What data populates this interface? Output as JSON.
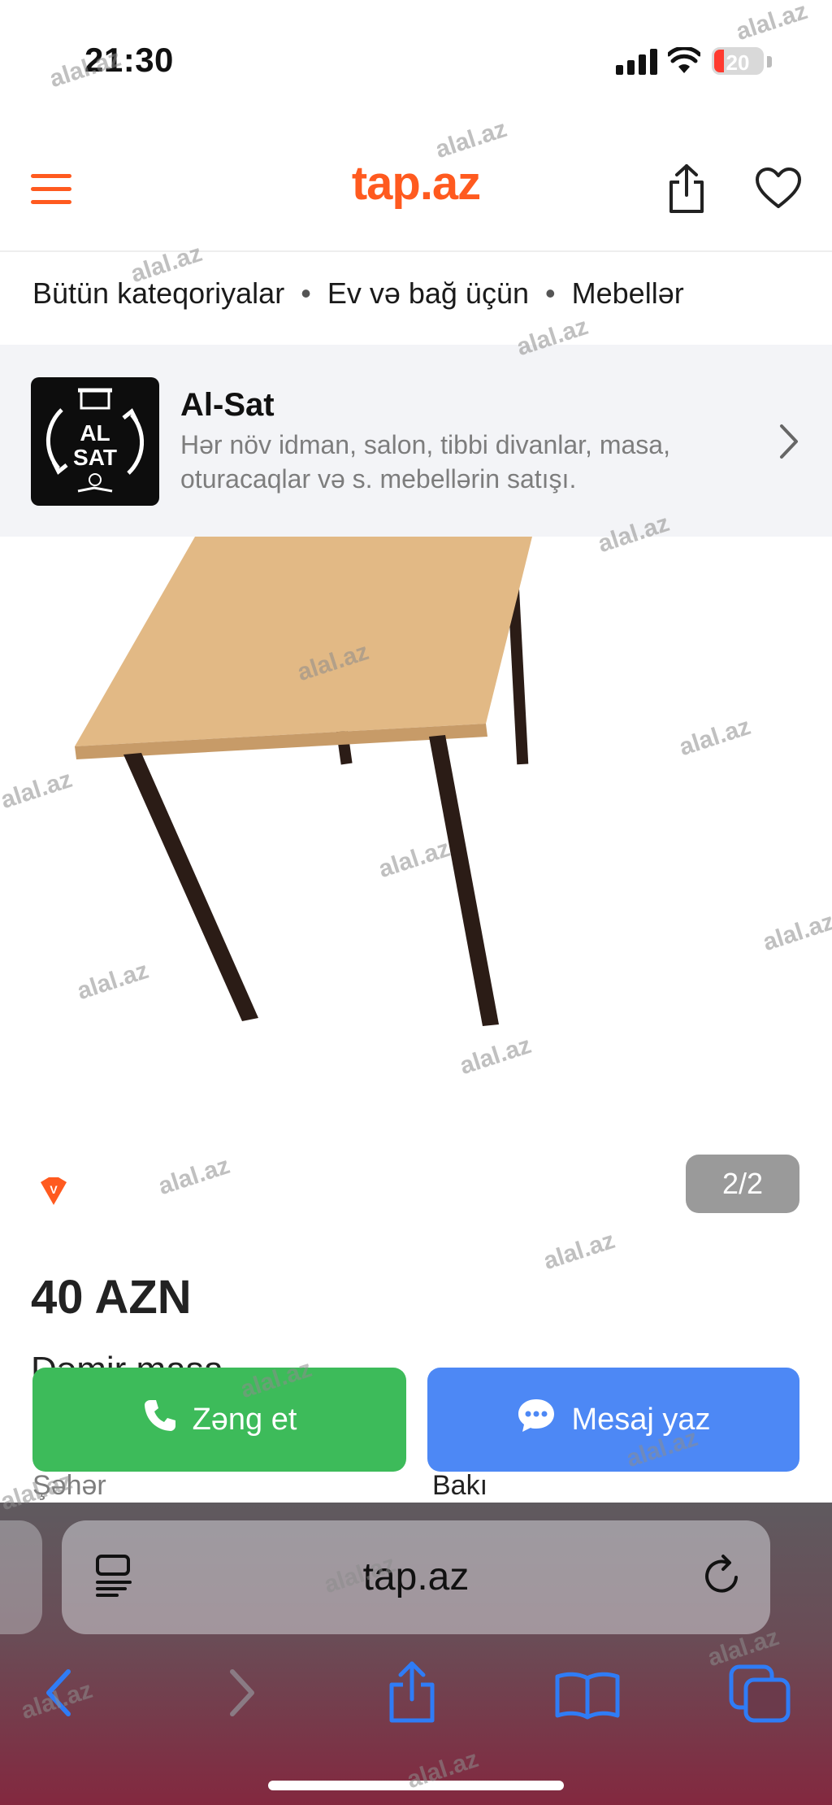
{
  "status_bar": {
    "time": "21:30",
    "battery": "20"
  },
  "header": {
    "logo": "tap.az"
  },
  "breadcrumb": {
    "items": [
      "Bütün kateqoriyalar",
      "Ev və bağ üçün",
      "Mebellər"
    ],
    "separator": "•"
  },
  "shop": {
    "name": "Al-Sat",
    "description": "Hər növ idman, salon, tibbi divanlar, masa, oturacaqlar və s. mebellərin satışı.",
    "logo_text_1": "AL",
    "logo_text_2": "SAT"
  },
  "listing": {
    "image_counter": "2/2",
    "vip_badge": "V",
    "price": "40 AZN",
    "title": "Dəmir masa",
    "city_label": "Şəhər",
    "city_value": "Bakı"
  },
  "actions": {
    "call_label": "Zəng et",
    "message_label": "Mesaj yaz"
  },
  "browser": {
    "url": "tap.az"
  },
  "watermark": {
    "text": "alal.az"
  },
  "colors": {
    "brand": "#ff5a1f",
    "call": "#3dbb5a",
    "message": "#4d88f5",
    "ios_blue": "#2f7cf6"
  }
}
